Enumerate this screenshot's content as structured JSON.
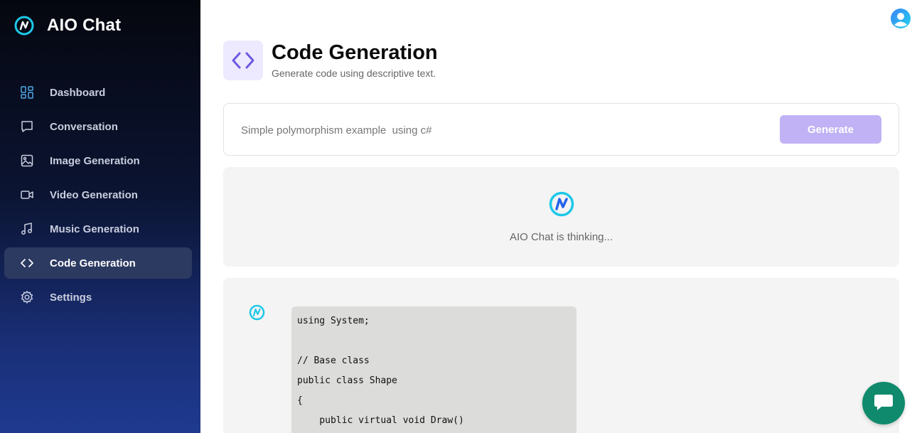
{
  "brand": {
    "name": "AIO Chat",
    "logo_icon": "aio-logo-icon",
    "accent": "#1ec8e8"
  },
  "sidebar": {
    "items": [
      {
        "label": "Dashboard",
        "icon": "dashboard-icon",
        "active": false
      },
      {
        "label": "Conversation",
        "icon": "message-icon",
        "active": false
      },
      {
        "label": "Image Generation",
        "icon": "image-icon",
        "active": false
      },
      {
        "label": "Video Generation",
        "icon": "video-icon",
        "active": false
      },
      {
        "label": "Music Generation",
        "icon": "music-icon",
        "active": false
      },
      {
        "label": "Code Generation",
        "icon": "code-icon",
        "active": true
      },
      {
        "label": "Settings",
        "icon": "gear-icon",
        "active": false
      }
    ]
  },
  "header": {
    "title": "Code Generation",
    "subtitle": "Generate code using descriptive text.",
    "icon": "code-icon",
    "icon_color": "#6a5ae0"
  },
  "prompt": {
    "value": "Simple polymorphism example  using c#",
    "button_label": "Generate",
    "button_color": "#c0b2f5"
  },
  "thinking": {
    "text": "AIO Chat is thinking..."
  },
  "response": {
    "code_lines": [
      "using System;",
      "",
      "// Base class",
      "public class Shape",
      "{",
      "    public virtual void Draw()"
    ]
  },
  "colors": {
    "sidebar_top": "#05070f",
    "sidebar_bottom": "#1e3a8f",
    "active_item": "#2c3a62",
    "chat_fab": "#0f8a6c"
  }
}
